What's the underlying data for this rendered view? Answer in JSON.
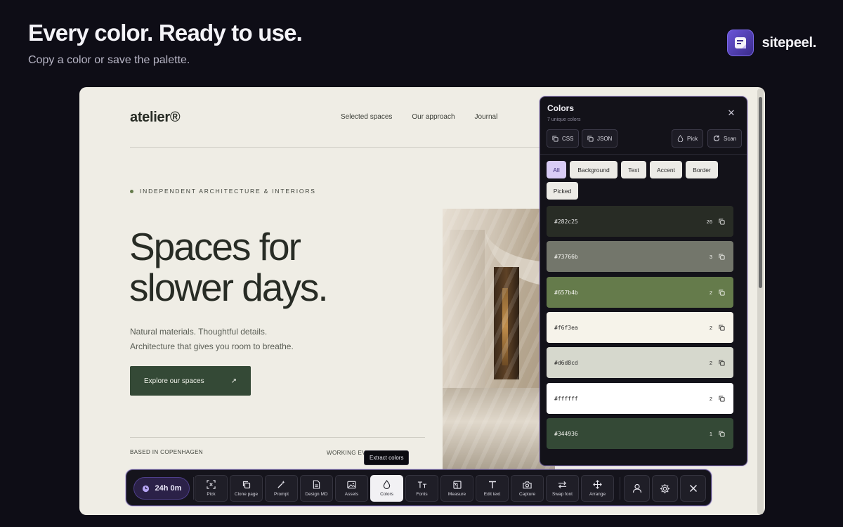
{
  "header": {
    "title": "Every color. Ready to use.",
    "subtitle": "Copy a color or save the palette.",
    "brand": "sitepeel."
  },
  "site": {
    "logo": "atelier®",
    "nav": [
      "Selected spaces",
      "Our approach",
      "Journal"
    ],
    "eyebrow": "INDEPENDENT ARCHITECTURE & INTERIORS",
    "hero_line1": "Spaces for",
    "hero_line2": "slower days.",
    "body_line1": "Natural materials. Thoughtful details.",
    "body_line2": "Architecture that gives you room to breathe.",
    "cta": "Explore our spaces",
    "cta_arrow": "↗",
    "footer_left": "BASED IN COPENHAGEN",
    "footer_right": "WORKING EV"
  },
  "panel": {
    "title": "Colors",
    "subtitle": "7 unique colors",
    "buttons": {
      "css": "CSS",
      "json": "JSON",
      "pick": "Pick",
      "scan": "Scan"
    },
    "filters": [
      "All",
      "Background",
      "Text",
      "Accent",
      "Border",
      "Picked"
    ],
    "active_filter": "All",
    "swatches": [
      {
        "hex": "#282c25",
        "count": "26",
        "text_color": "#e8e8e8"
      },
      {
        "hex": "#73766b",
        "count": "3",
        "text_color": "#f4f4f0"
      },
      {
        "hex": "#657b4b",
        "count": "2",
        "text_color": "#f4f4f0"
      },
      {
        "hex": "#f6f3ea",
        "count": "2",
        "text_color": "#2a2a2a"
      },
      {
        "hex": "#d6d8cd",
        "count": "2",
        "text_color": "#2a2a2a"
      },
      {
        "hex": "#ffffff",
        "count": "2",
        "text_color": "#2a2a2a"
      },
      {
        "hex": "#344936",
        "count": "1",
        "text_color": "#f4f4f0"
      }
    ]
  },
  "tooltip": "Extract colors",
  "toolbar": {
    "timer": "24h 0m",
    "tools": [
      "Pick",
      "Clone page",
      "Prompt",
      "Design MD",
      "Assets",
      "Colors",
      "Fonts",
      "Measure",
      "Edit text",
      "Capture",
      "Swap font",
      "Arrange"
    ],
    "active_tool": "Colors"
  },
  "colors": {
    "accent": "#7a68e8",
    "page_bg": "#0e0d16",
    "site_bg": "#efede5"
  }
}
